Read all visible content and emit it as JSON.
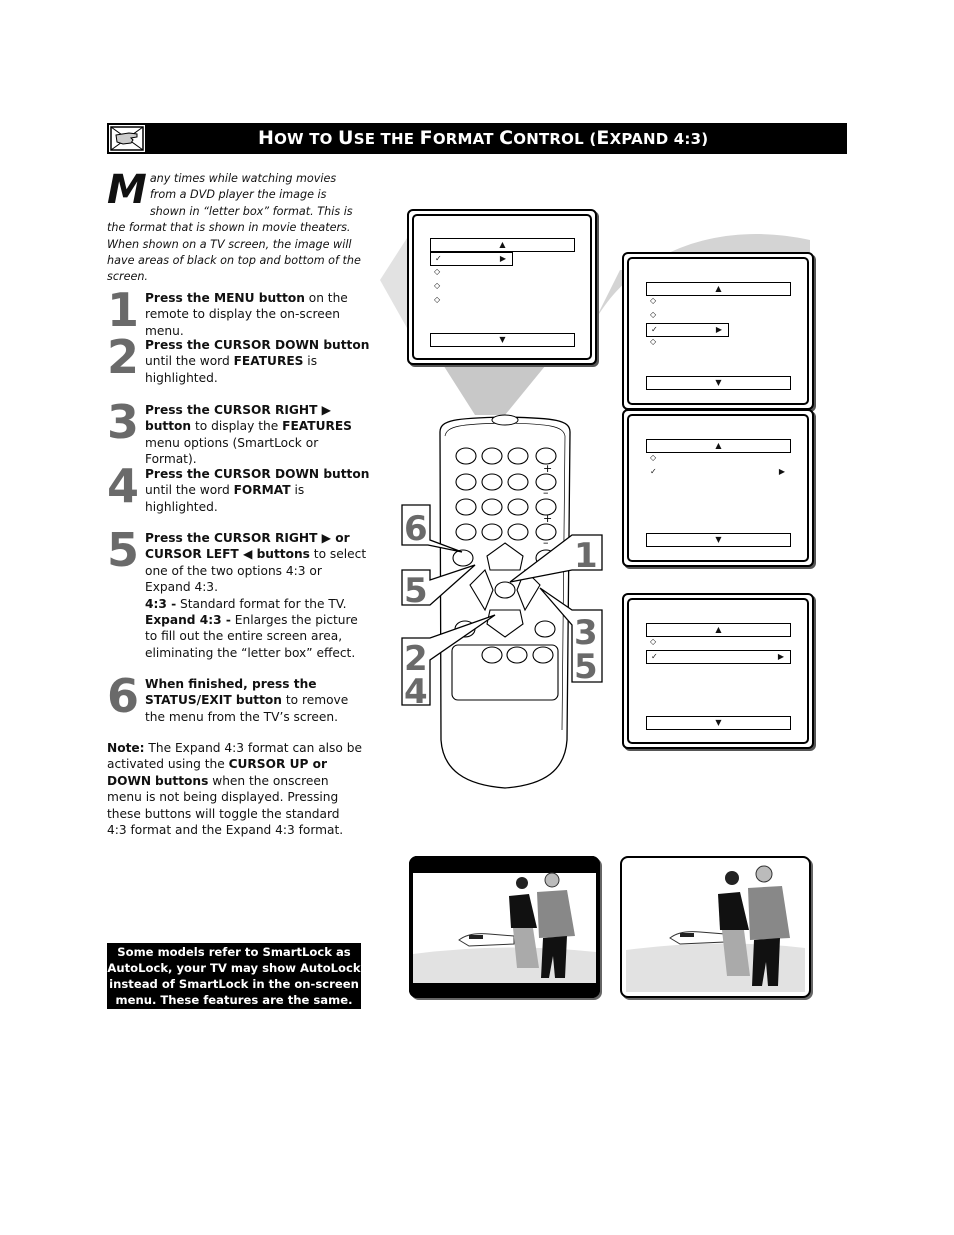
{
  "header": {
    "icon": "hand-pointing-icon",
    "title_parts": [
      {
        "cap": "H",
        "rest": "OW TO "
      },
      {
        "cap": "U",
        "rest": "SE THE "
      },
      {
        "cap": "F",
        "rest": "ORMAT "
      },
      {
        "cap": "C",
        "rest": "ONTROL ("
      },
      {
        "cap": "E",
        "rest": "XPAND 4:3)"
      }
    ],
    "title": "How to Use the Format Control (Expand 4:3)"
  },
  "intro": {
    "drop_cap": "M",
    "text": "any times while watching movies from a DVD player the image is shown in “letter box” format. This is the format that is shown in movie theaters. When shown on a TV screen, the image will have areas of black on top and bottom of the screen."
  },
  "steps": [
    {
      "num": "1",
      "bold1": "Press the MENU button",
      "text1": " on the remote to display the on-screen menu."
    },
    {
      "num": "2",
      "bold1": "Press the CURSOR DOWN button",
      "text1": " until the word ",
      "bold2": "FEATURES",
      "text2": " is highlighted."
    },
    {
      "num": "3",
      "bold1": "Press the CURSOR RIGHT ▶ button",
      "text1": " to display the ",
      "bold2": "FEATURES",
      "text2": " menu options (SmartLock or Format)."
    },
    {
      "num": "4",
      "bold1": "Press the CURSOR DOWN button",
      "text1": " until the word ",
      "bold2": "FORMAT",
      "text2": " is highlighted."
    },
    {
      "num": "5",
      "bold1": "Press the CURSOR RIGHT ▶ or CURSOR LEFT ◀ buttons",
      "text1": " to select one of the two options 4:3 or Expand 4:3.",
      "opt1_label": "4:3 -",
      "opt1_text": " Standard format for the TV.",
      "opt2_label": "Expand 4:3 -",
      "opt2_text": " Enlarges the picture to fill out the entire screen area, eliminating the “letter box” effect."
    },
    {
      "num": "6",
      "bold1": "When finished, press the STATUS/EXIT button",
      "text1": " to remove the menu from the TV’s screen."
    }
  ],
  "note": {
    "label": "Note:",
    "text1": "  The Expand 4:3 format can also be activated using the ",
    "bold1": "CURSOR UP",
    "text2": "  or ",
    "bold2": "DOWN",
    "text3": "  ",
    "bold3": "buttons",
    "text4": " when the onscreen menu is not being displayed. Pressing these buttons will toggle the standard 4:3 format and the Expand 4:3 format."
  },
  "callout": "Some models refer to SmartLock as AutoLock, your TV may show AutoLock instead of SmartLock in the on-screen menu. These features are the same.",
  "remote": {
    "callouts": [
      "6",
      "5",
      "2",
      "4",
      "1",
      "3",
      "5"
    ],
    "plus": "+",
    "minus": "–"
  },
  "menus": {
    "up_arrow": "▲",
    "down_arrow": "▼",
    "right_arrow": "▶",
    "check": "✓",
    "diamond": "◇"
  },
  "pictures": [
    {
      "name": "letterbox-picture",
      "label": "letter box"
    },
    {
      "name": "expanded-picture",
      "label": "Expand 4:3"
    }
  ]
}
